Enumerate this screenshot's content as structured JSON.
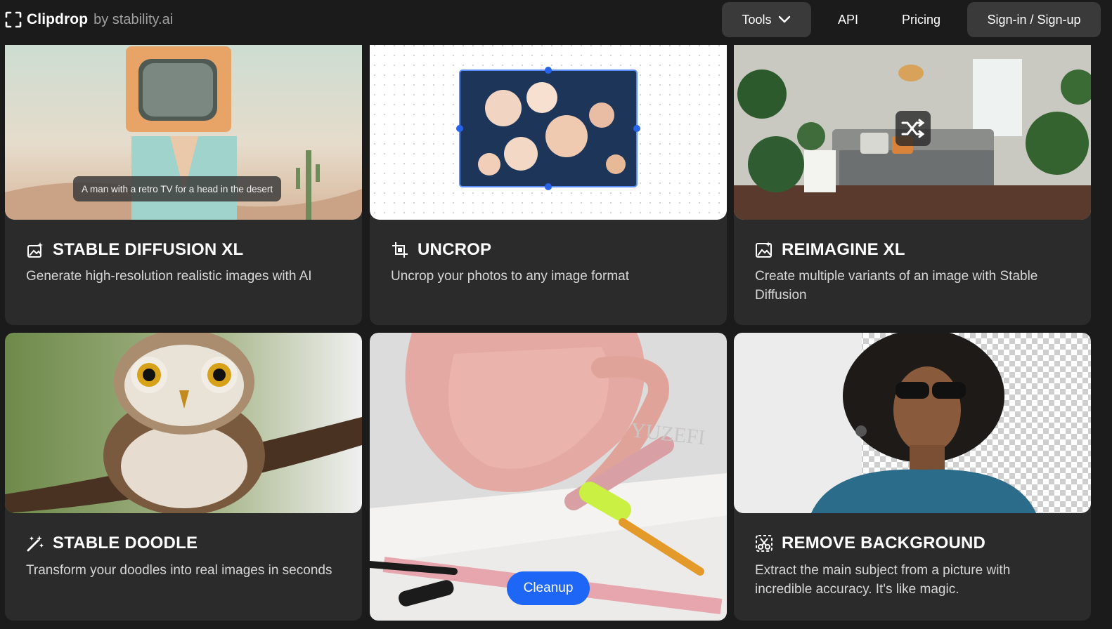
{
  "header": {
    "brand_name": "Clipdrop",
    "brand_by": "by stability.ai",
    "nav": {
      "tools_label": "Tools",
      "api_label": "API",
      "pricing_label": "Pricing",
      "signin_label": "Sign-in / Sign-up"
    }
  },
  "cards": [
    {
      "title": "STABLE DIFFUSION XL",
      "description": "Generate high-resolution realistic images with AI",
      "image_caption": "A man with a retro TV for a head in the desert",
      "icon": "image-sparkle-icon"
    },
    {
      "title": "UNCROP",
      "description": "Uncrop your photos to any image format",
      "icon": "crop-icon"
    },
    {
      "title": "REIMAGINE XL",
      "description": "Create multiple variants of an image with Stable Diffusion",
      "icon": "image-variant-icon"
    },
    {
      "title": "STABLE DOODLE",
      "description": "Transform your doodles into real images in seconds",
      "icon": "magic-wand-icon"
    },
    {
      "cleanup_label": "Cleanup"
    },
    {
      "title": "REMOVE BACKGROUND",
      "description": "Extract the main subject from a picture with incredible accuracy. It's like magic.",
      "icon": "scissors-icon"
    }
  ],
  "colors": {
    "background": "#1b1b1b",
    "card": "#2b2b2b",
    "accent": "#1e66f5"
  }
}
